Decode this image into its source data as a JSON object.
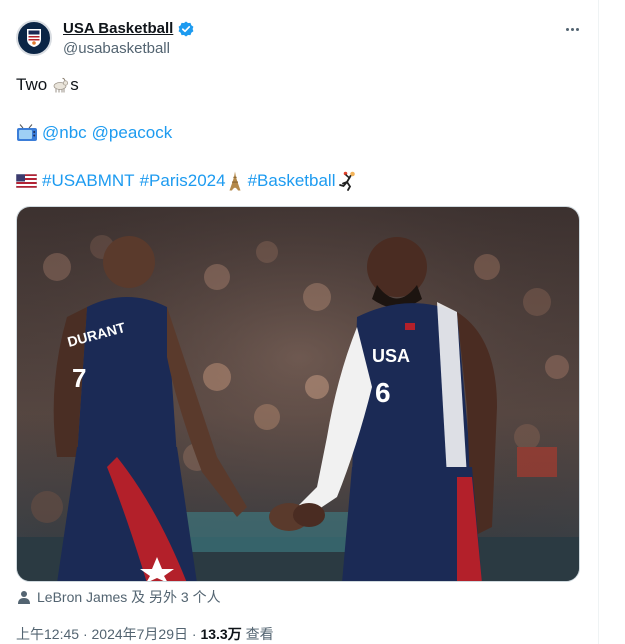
{
  "author": {
    "display_name": "USA Basketball",
    "handle": "@usabasketball",
    "verified": true
  },
  "menu": {
    "icon": "more-horizontal-icon"
  },
  "tweet": {
    "line1": {
      "prefix": "Two",
      "emoji": "goat-emoji",
      "suffix": "s"
    },
    "line2": {
      "emoji": "tv-emoji",
      "mentions": [
        "@nbc",
        "@peacock"
      ]
    },
    "line3": {
      "emoji": "us-flag-emoji",
      "hashtag1": "#USABMNT",
      "hashtag2": "#Paris2024",
      "tower_emoji": "eiffel-tower-emoji",
      "hashtag3": "#Basketball",
      "hand_emoji": "person-playing-handball-emoji"
    }
  },
  "media": {
    "type": "photo",
    "jersey_left": "DURANT 7",
    "jersey_right": "USA 6"
  },
  "tagged": {
    "icon": "person-icon",
    "text": "LeBron James 及 另外 3 个人"
  },
  "meta": {
    "time": "上午12:45",
    "separator": "·",
    "date": "2024年7月29日",
    "views_count": "13.3万",
    "views_label": "查看"
  },
  "colors": {
    "link": "#1d9bf0",
    "text": "#0f1419",
    "secondary": "#536471",
    "navy": "#1b2a55",
    "red": "#b3202a"
  }
}
